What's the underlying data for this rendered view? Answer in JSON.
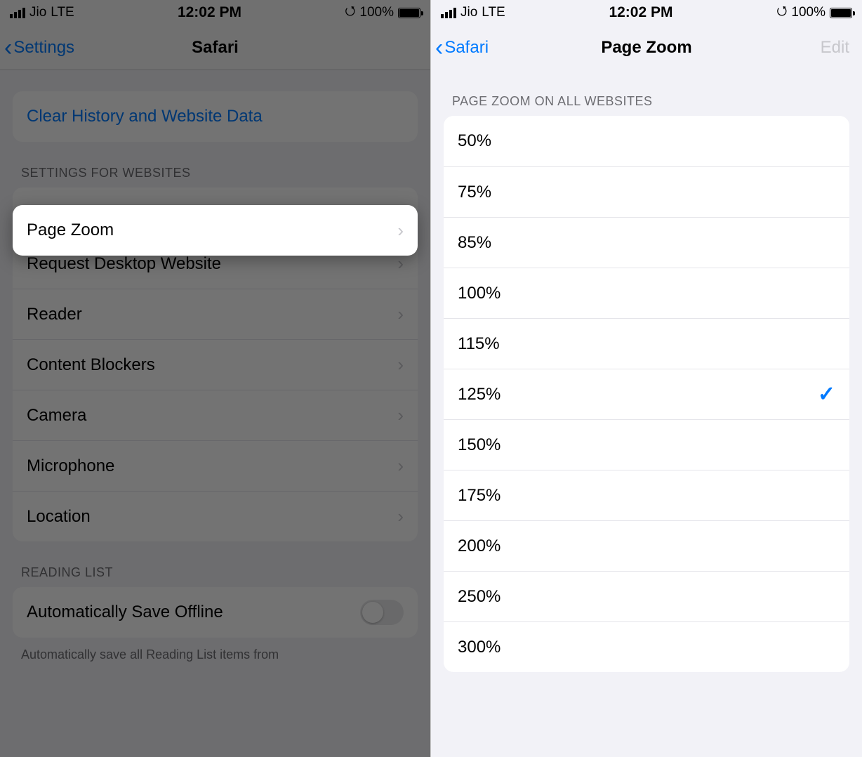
{
  "left": {
    "status": {
      "carrier": "Jio",
      "network": "LTE",
      "time": "12:02 PM",
      "battery": "100%"
    },
    "nav": {
      "back": "Settings",
      "title": "Safari"
    },
    "clear_btn": "Clear History and Website Data",
    "section_websites": "SETTINGS FOR WEBSITES",
    "rows": {
      "page_zoom": "Page Zoom",
      "desktop": "Request Desktop Website",
      "reader": "Reader",
      "blockers": "Content Blockers",
      "camera": "Camera",
      "microphone": "Microphone",
      "location": "Location"
    },
    "section_reading": "READING LIST",
    "auto_save": "Automatically Save Offline",
    "footer": "Automatically save all Reading List items from"
  },
  "right": {
    "status": {
      "carrier": "Jio",
      "network": "LTE",
      "time": "12:02 PM",
      "battery": "100%"
    },
    "nav": {
      "back": "Safari",
      "title": "Page Zoom",
      "edit": "Edit"
    },
    "section": "PAGE ZOOM ON ALL WEBSITES",
    "options": [
      "50%",
      "75%",
      "85%",
      "100%",
      "115%",
      "125%",
      "150%",
      "175%",
      "200%",
      "250%",
      "300%"
    ],
    "selected": "125%"
  }
}
